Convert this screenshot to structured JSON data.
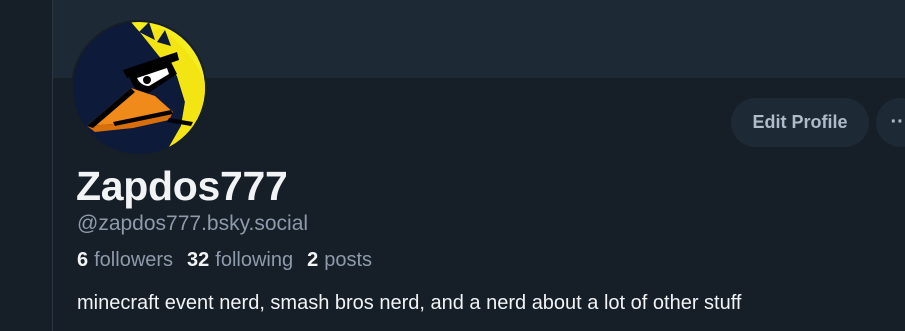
{
  "profile": {
    "display_name": "Zapdos777",
    "handle": "@zapdos777.bsky.social",
    "bio": "minecraft event nerd, smash bros nerd, and a nerd about a lot of other stuff",
    "avatar_icon": "zapdos-avatar"
  },
  "stats": {
    "followers": {
      "count": "6",
      "label": "followers"
    },
    "following": {
      "count": "32",
      "label": "following"
    },
    "posts": {
      "count": "2",
      "label": "posts"
    }
  },
  "actions": {
    "edit_profile_label": "Edit Profile",
    "more_label": "···",
    "more_icon": "ellipsis-icon"
  },
  "colors": {
    "background": "#161e27",
    "banner": "#1e2936",
    "button_bg": "#1e2936",
    "text_primary": "#f1f3f5",
    "text_secondary": "#8d9aab"
  }
}
